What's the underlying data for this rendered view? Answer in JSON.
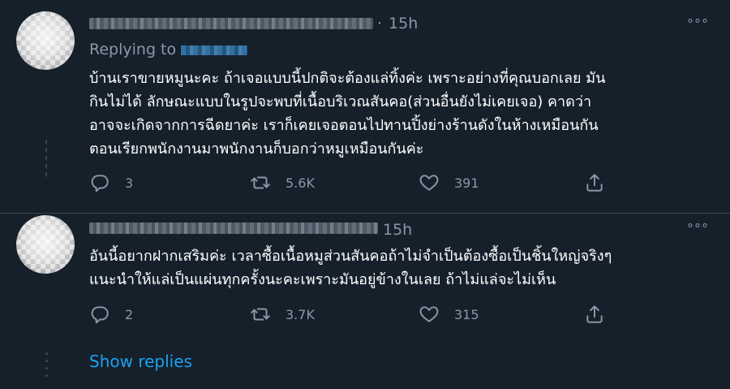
{
  "tweets": [
    {
      "time": "15h",
      "more_glyph": "°°°",
      "replying_label": "Replying to",
      "text_lines": [
        "บ้านเราขายหมูนะคะ ถ้าเจอแบบนี้ปกติจะต้องแล่ทิ้งค่ะ เพราะอย่างที่คุณบอกเลย มัน",
        "กินไม่ได้ ลักษณะแบบในรูปจะพบที่เนื้อบริเวณสันคอ(ส่วนอื่นยังไม่เคยเจอ) คาดว่า",
        "อาจจะเกิดจากการฉีดยาค่ะ เราก็เคยเจอตอนไปทานปิ้งย่างร้านดังในห้างเหมือนกัน",
        "ตอนเรียกพนักงานมาพนักงานก็บอกว่าหมูเหมือนกันค่ะ"
      ],
      "replies": "3",
      "retweets": "5.6K",
      "likes": "391"
    },
    {
      "time": "15h",
      "more_glyph": "°°°",
      "text_lines": [
        "อันนี้อยากฝากเสริมค่ะ เวลาซื้อเนื้อหมูส่วนสันคอถ้าไม่จำเป็นต้องซื้อเป็นชิ้นใหญ่จริงๆ",
        "แนะนำให้แล่เป็นแผ่นทุกครั้งนะคะเพราะมันอยู่ข้างในเลย ถ้าไม่แล่จะไม่เห็น"
      ],
      "replies": "2",
      "retweets": "3.7K",
      "likes": "315",
      "show_replies": "Show replies"
    }
  ],
  "icons": {
    "reply": "reply-icon",
    "retweet": "retweet-icon",
    "like": "heart-icon",
    "share": "share-icon"
  },
  "colors": {
    "background": "#15202b",
    "text": "#ffffff",
    "secondary": "#8899a6",
    "link": "#1da1f2",
    "border": "#38444d"
  }
}
